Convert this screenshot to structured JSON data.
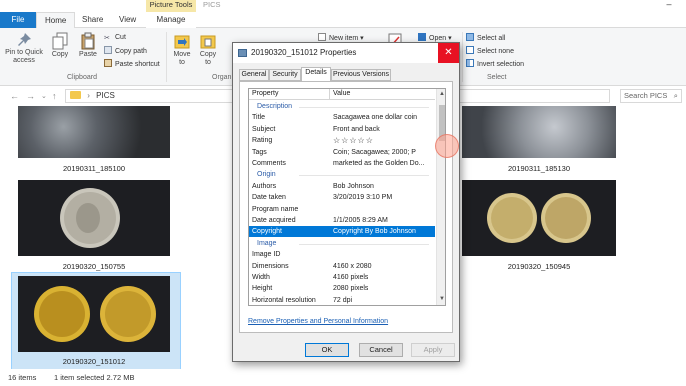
{
  "titlebar": {
    "context_tab": "Picture Tools",
    "context_title": "PICS",
    "minimize": "–"
  },
  "ribbon_tabs": {
    "file": "File",
    "home": "Home",
    "share": "Share",
    "view": "View",
    "manage": "Manage"
  },
  "ribbon": {
    "pin": "Pin to Quick access",
    "copy": "Copy",
    "paste": "Paste",
    "cut": "Cut",
    "copy_path": "Copy path",
    "paste_shortcut": "Paste shortcut",
    "clipboard_group": "Clipboard",
    "move_to": "Move to",
    "copy_to": "Copy to",
    "organize_group": "Organ",
    "new_item": "New item",
    "open": "Open",
    "select_all": "Select all",
    "select_none": "Select none",
    "invert_selection": "Invert selection",
    "select_group": "Select"
  },
  "address": {
    "path": "PICS",
    "search_placeholder": "Search PICS"
  },
  "files": [
    {
      "name": "20190311_185100"
    },
    {
      "name": "20190311_185130"
    },
    {
      "name": "20190320_150755"
    },
    {
      "name": "20190320_150945"
    },
    {
      "name": "20190320_151012"
    }
  ],
  "status": {
    "items": "16 items",
    "selected": "1 item selected  2.72 MB"
  },
  "dialog": {
    "title": "20190320_151012 Properties",
    "close": "✕",
    "tabs": [
      "General",
      "Security",
      "Details",
      "Previous Versions"
    ],
    "header": {
      "property": "Property",
      "value": "Value"
    },
    "rows": [
      {
        "type": "section",
        "k": "Description"
      },
      {
        "k": "Title",
        "v": "Sacagawea one dollar coin"
      },
      {
        "k": "Subject",
        "v": "Front and back"
      },
      {
        "k": "Rating",
        "v": "☆☆☆☆☆"
      },
      {
        "k": "Tags",
        "v": "Coin; Sacagawea; 2000; P"
      },
      {
        "k": "Comments",
        "v": "marketed as the Golden Do..."
      },
      {
        "type": "section",
        "k": "Origin"
      },
      {
        "k": "Authors",
        "v": "Bob Johnson"
      },
      {
        "k": "Date taken",
        "v": "3/20/2019 3:10 PM"
      },
      {
        "k": "Program name",
        "v": ""
      },
      {
        "k": "Date acquired",
        "v": "1/1/2005 8:29 AM"
      },
      {
        "k": "Copyright",
        "v": "Copyright By Bob Johnson",
        "highlight": true
      },
      {
        "type": "section",
        "k": "Image"
      },
      {
        "k": "Image ID",
        "v": ""
      },
      {
        "k": "Dimensions",
        "v": "4160 x 2080"
      },
      {
        "k": "Width",
        "v": "4160 pixels"
      },
      {
        "k": "Height",
        "v": "2080 pixels"
      },
      {
        "k": "Horizontal resolution",
        "v": "72 dpi"
      }
    ],
    "remove_link": "Remove Properties and Personal Information",
    "ok": "OK",
    "cancel": "Cancel",
    "apply": "Apply"
  }
}
